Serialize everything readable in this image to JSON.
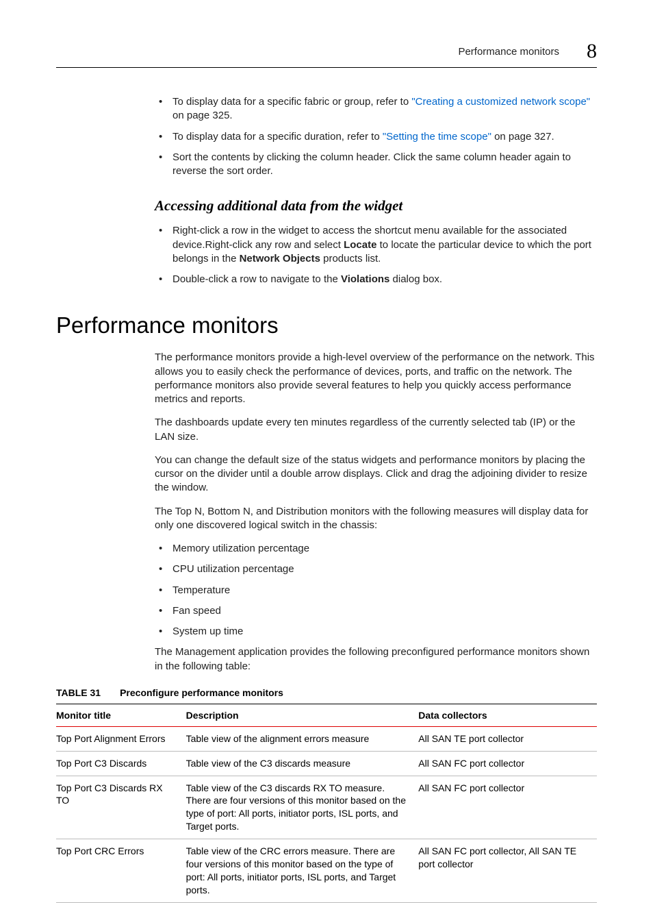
{
  "header": {
    "running_title": "Performance monitors",
    "chapter_number": "8"
  },
  "top_bullets": {
    "b1_pre": "To display data for a specific fabric or group, refer to ",
    "b1_link": "\"Creating a customized network scope\"",
    "b1_post": " on page 325.",
    "b2_pre": "To display data for a specific duration, refer to ",
    "b2_link": "\"Setting the time scope\"",
    "b2_post": " on page 327.",
    "b3": "Sort the contents by clicking the column header. Click the same column header again to reverse the sort order."
  },
  "sub1": {
    "heading": "Accessing additional data from the widget",
    "b1_a": "Right-click a row in the widget to access the shortcut menu available for the associated device.Right-click any row and select ",
    "b1_bold1": "Locate",
    "b1_b": " to locate the particular device to which the port belongs in the ",
    "b1_bold2": "Network Objects",
    "b1_c": " products list.",
    "b2_a": "Double-click a row to navigate to the ",
    "b2_bold": "Violations",
    "b2_b": " dialog box."
  },
  "section": {
    "title": "Performance monitors",
    "p1": "The performance monitors provide a high-level overview of the performance on the network. This allows you to easily check the performance of devices, ports, and traffic on the network. The performance monitors also provide several features to help you quickly access performance metrics and reports.",
    "p2": "The dashboards update every ten minutes regardless of the currently selected tab (IP) or the LAN size.",
    "p3": "You can change the default size of the status widgets and performance monitors by placing the cursor on the divider until a double arrow displays. Click and drag the adjoining divider to resize the window.",
    "p4": "The Top N, Bottom N, and Distribution monitors with the following measures will display data for only one discovered logical switch in the chassis:",
    "measures": {
      "m1": "Memory utilization percentage",
      "m2": "CPU utilization percentage",
      "m3": "Temperature",
      "m4": "Fan speed",
      "m5": "System up time"
    },
    "p5": "The Management application provides the following preconfigured performance monitors shown in the following table:"
  },
  "table": {
    "number": "TABLE 31",
    "title": "Preconfigure performance monitors",
    "headers": {
      "h1": "Monitor title",
      "h2": "Description",
      "h3": "Data collectors"
    },
    "rows": {
      "r1": {
        "c1": "Top Port Alignment Errors",
        "c2": "Table view of the alignment errors measure",
        "c3": "All SAN TE port collector"
      },
      "r2": {
        "c1": "Top Port C3 Discards",
        "c2": "Table view of the C3 discards measure",
        "c3": "All SAN FC port collector"
      },
      "r3": {
        "c1": "Top Port C3 Discards RX TO",
        "c2": "Table view of the C3 discards RX TO measure. There are four versions of this monitor based on the type of port: All ports, initiator ports, ISL ports, and Target ports.",
        "c3": "All SAN FC port collector"
      },
      "r4": {
        "c1": "Top Port CRC Errors",
        "c2": "Table view of the CRC errors measure. There are four versions of this monitor based on the type of port: All ports, initiator ports, ISL ports, and Target ports.",
        "c3": "All SAN FC port collector, All SAN TE port collector"
      }
    }
  }
}
